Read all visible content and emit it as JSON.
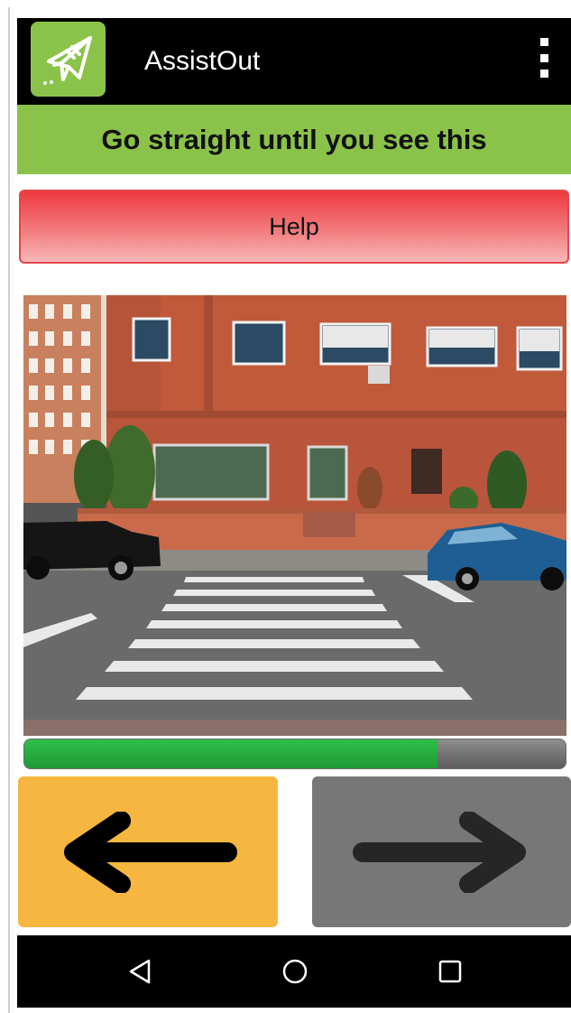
{
  "action_bar": {
    "title": "AssistOut",
    "logo_icon": "paper-plane-icon",
    "menu_icon": "overflow-menu-icon",
    "background": "#000000",
    "logo_color": "#8bc34a"
  },
  "instruction": {
    "text": "Go straight until you see this",
    "background": "#8bc34a"
  },
  "help_button": {
    "label": "Help",
    "color": "#ee3a3f"
  },
  "landmark_photo": {
    "subject": "crosswalk-in-front-of-brick-building"
  },
  "progress": {
    "value": 0.764,
    "fill_color": "#2fbf4a"
  },
  "navigation": {
    "back_icon": "arrow-left-icon",
    "back_color": "#f7b63f",
    "next_icon": "arrow-right-icon",
    "next_color": "#777777"
  },
  "system_nav": {
    "back_icon": "triangle-back-icon",
    "home_icon": "circle-home-icon",
    "recents_icon": "square-recents-icon"
  }
}
